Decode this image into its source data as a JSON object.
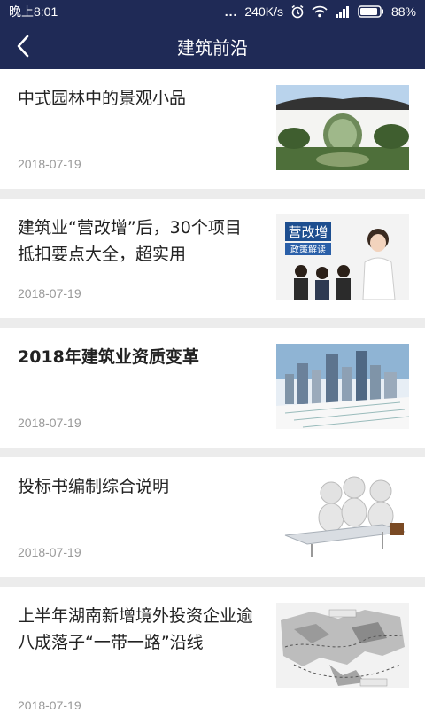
{
  "status_bar": {
    "time": "晚上8:01",
    "dots": "...",
    "speed": "240K/s",
    "battery": "88%"
  },
  "header": {
    "title": "建筑前沿"
  },
  "articles": [
    {
      "title": "中式园林中的景观小品",
      "date": "2018-07-19",
      "image": "chinese-garden-gate"
    },
    {
      "title": "建筑业“营改增”后，30个项目抵扣要点大全，超实用",
      "date": "2018-07-19",
      "image": "tax-policy-business-people",
      "image_text": {
        "main": "营改增",
        "sub": "政策解读"
      }
    },
    {
      "title": "2018年建筑业资质变革",
      "date": "2018-07-19",
      "image": "city-skyline-blueprint"
    },
    {
      "title": "投标书编制综合说明",
      "date": "2018-07-19",
      "image": "3d-figures-meeting-table"
    },
    {
      "title": "上半年湖南新增境外投资企业逾八成落子“一带一路”沿线",
      "date": "2018-07-19",
      "image": "belt-and-road-map"
    }
  ],
  "colors": {
    "header_bg": "#1f2a56",
    "page_bg": "#ececec",
    "date_text": "#999999"
  }
}
